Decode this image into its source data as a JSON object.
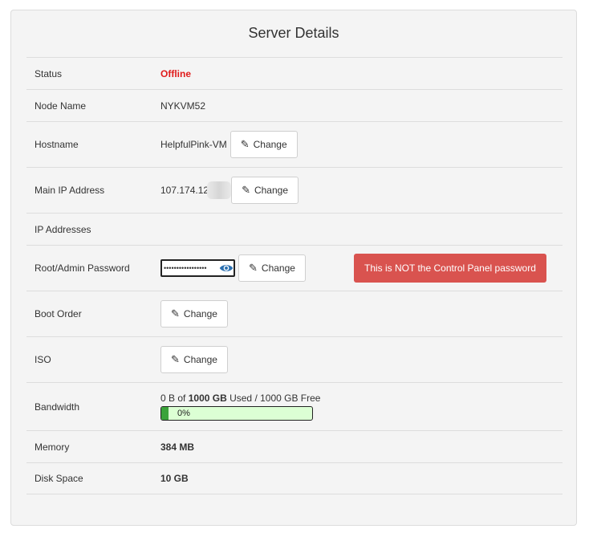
{
  "title": "Server Details",
  "rows": {
    "status": {
      "label": "Status",
      "value": "Offline"
    },
    "node": {
      "label": "Node Name",
      "value": "NYKVM52"
    },
    "hostname": {
      "label": "Hostname",
      "value": "HelpfulPink-VM",
      "button": "Change"
    },
    "main_ip": {
      "label": "Main IP Address",
      "value": "107.174.12",
      "button": "Change"
    },
    "ip_addresses": {
      "label": "IP Addresses"
    },
    "password": {
      "label": "Root/Admin Password",
      "value": "•••••••••••••••••",
      "button": "Change",
      "warning": "This is NOT the Control Panel password"
    },
    "boot_order": {
      "label": "Boot Order",
      "button": "Change"
    },
    "iso": {
      "label": "ISO",
      "button": "Change"
    },
    "bandwidth": {
      "label": "Bandwidth",
      "used": "0 B",
      "of": "of",
      "total": "1000 GB",
      "suffix": "Used / 1000 GB Free",
      "percent_text": "0%",
      "percent": 0
    },
    "memory": {
      "label": "Memory",
      "value": "384 MB"
    },
    "disk": {
      "label": "Disk Space",
      "value": "10 GB"
    }
  },
  "colors": {
    "offline": "#e01b1b",
    "warning_bg": "#d9534f",
    "progress_fill": "#3aa33a",
    "progress_bg": "#dcffd4"
  }
}
